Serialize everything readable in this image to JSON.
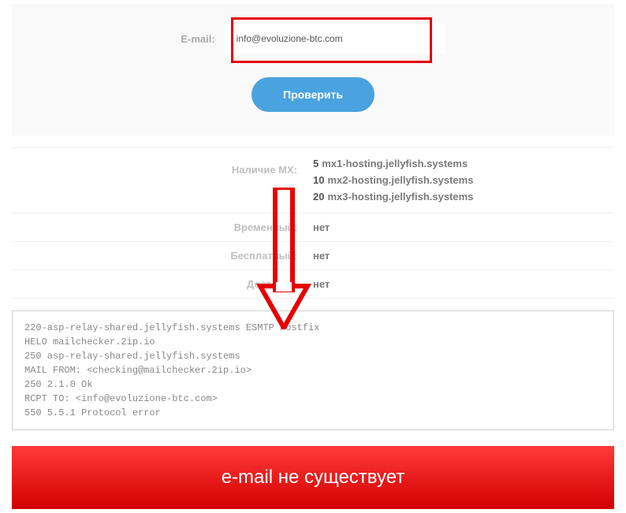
{
  "form": {
    "label": "E-mail:",
    "value": "info@evoluzione-btc.com",
    "button": "Проверить"
  },
  "info": {
    "mx": {
      "label": "Наличие MX:",
      "records": [
        {
          "priority": "5",
          "host": "mx1-hosting.jellyfish.systems"
        },
        {
          "priority": "10",
          "host": "mx2-hosting.jellyfish.systems"
        },
        {
          "priority": "20",
          "host": "mx3-hosting.jellyfish.systems"
        }
      ]
    },
    "temporary": {
      "label": "Временный:",
      "value": "нет"
    },
    "free": {
      "label": "Бесплатный:",
      "value": "нет"
    },
    "delivery": {
      "label": "Доставка:",
      "value": "нет"
    }
  },
  "terminal": [
    "220-asp-relay-shared.jellyfish.systems ESMTP Postfix",
    "HELO mailchecker.2ip.io",
    "250 asp-relay-shared.jellyfish.systems",
    "MAIL FROM: <checking@mailchecker.2ip.io>",
    "250 2.1.0 Ok",
    "RCPT TO: <info@evoluzione-btc.com>",
    "550 5.5.1 Protocol error"
  ],
  "result": "e-mail не существует"
}
